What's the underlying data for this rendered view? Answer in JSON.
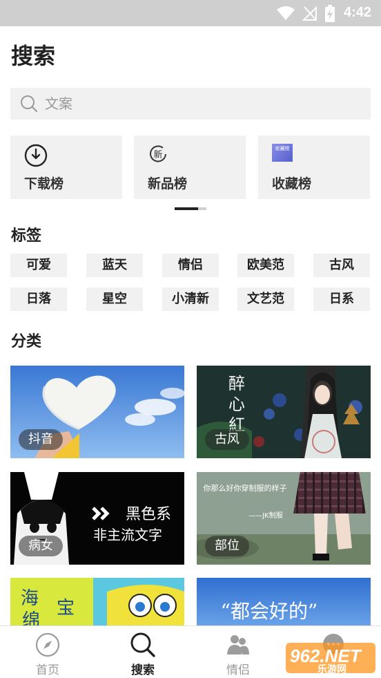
{
  "status_bar": {
    "time": "4:42"
  },
  "page": {
    "title": "搜索"
  },
  "search": {
    "placeholder": "文案"
  },
  "rankings": [
    {
      "label": "下载榜",
      "icon": "download-clock-icon"
    },
    {
      "label": "新品榜",
      "icon": "new-badge-icon"
    },
    {
      "label": "收藏榜",
      "icon": "favorites-thumbnail-icon",
      "icon_text": "收藏榜"
    }
  ],
  "tags_section": {
    "title": "标签",
    "tags": [
      "可爱",
      "蓝天",
      "情侣",
      "欧美范",
      "古风",
      "日落",
      "星空",
      "小清新",
      "文艺范",
      "日系"
    ]
  },
  "category_section": {
    "title": "分类",
    "cards": [
      {
        "label": "抖音",
        "theme": "sky-heart"
      },
      {
        "label": "古风",
        "theme": "ancient-girl",
        "art_text": [
          "醉",
          "心",
          "紅"
        ]
      },
      {
        "label": "病女",
        "theme": "black-anime",
        "art_text": [
          "黑色系",
          "非主流文字"
        ]
      },
      {
        "label": "部位",
        "theme": "plaid-skirt",
        "art_text": [
          "你那么好你穿制服的样子",
          "——JK制服"
        ]
      },
      {
        "label": "",
        "theme": "spongebob",
        "art_text": [
          "海",
          "绵",
          "宝"
        ]
      },
      {
        "label": "",
        "theme": "blue-text",
        "art_text": [
          "“都会好的”"
        ]
      }
    ]
  },
  "bottom_nav": [
    {
      "label": "首页",
      "icon": "compass-icon",
      "active": false
    },
    {
      "label": "搜索",
      "icon": "search-icon",
      "active": true
    },
    {
      "label": "情侣",
      "icon": "couple-icon",
      "active": false
    },
    {
      "label": "",
      "icon": "chat-icon",
      "active": false
    }
  ],
  "watermark": {
    "text": "962.NET",
    "sub": "乐游网"
  },
  "colors": {
    "accent": "#222222",
    "tile_bg": "#f1f1f1",
    "statusbar": "#cfcfcf",
    "inactive": "#999999"
  }
}
